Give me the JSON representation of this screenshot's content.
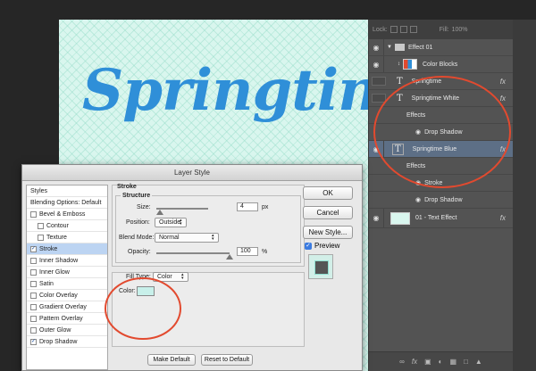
{
  "canvas": {
    "title_text": "Springtime"
  },
  "layers_panel": {
    "lock_label": "Lock:",
    "fill_label": "Fill:",
    "fill_value": "100%",
    "rows": [
      {
        "name": "Effect 01",
        "type": "group"
      },
      {
        "name": "Color Blocks",
        "type": "smart"
      },
      {
        "name": "Springtime",
        "type": "text",
        "fx": "fx"
      },
      {
        "name": "Springtime White",
        "type": "text",
        "fx": "fx"
      },
      {
        "name": "Effects",
        "type": "effects-header"
      },
      {
        "name": "Drop Shadow",
        "type": "effect"
      },
      {
        "name": "Springtime Blue",
        "type": "text",
        "fx": "fx",
        "selected": true
      },
      {
        "name": "Effects",
        "type": "effects-header"
      },
      {
        "name": "Stroke",
        "type": "effect"
      },
      {
        "name": "Drop Shadow",
        "type": "effect"
      },
      {
        "name": "01 - Text Effect",
        "type": "image",
        "fx": "fx"
      }
    ],
    "bottom_icons": [
      "link-icon",
      "fx-icon",
      "mask-icon",
      "adjustment-icon",
      "folder-icon",
      "new-layer-icon",
      "trash-icon"
    ]
  },
  "dialog": {
    "title": "Layer Style",
    "styles_header": "Styles",
    "blending": "Blending Options: Default",
    "style_items": [
      {
        "label": "Bevel & Emboss",
        "checked": false
      },
      {
        "label": "Contour",
        "checked": false,
        "indent": true
      },
      {
        "label": "Texture",
        "checked": false,
        "indent": true
      },
      {
        "label": "Stroke",
        "checked": true,
        "selected": true
      },
      {
        "label": "Inner Shadow",
        "checked": false
      },
      {
        "label": "Inner Glow",
        "checked": false
      },
      {
        "label": "Satin",
        "checked": false
      },
      {
        "label": "Color Overlay",
        "checked": false
      },
      {
        "label": "Gradient Overlay",
        "checked": false
      },
      {
        "label": "Pattern Overlay",
        "checked": false
      },
      {
        "label": "Outer Glow",
        "checked": false
      },
      {
        "label": "Drop Shadow",
        "checked": true
      }
    ],
    "stroke": {
      "section": "Stroke",
      "structure": "Structure",
      "size_label": "Size:",
      "size_value": "4",
      "size_unit": "px",
      "position_label": "Position:",
      "position_value": "Outside",
      "blend_label": "Blend Mode:",
      "blend_value": "Normal",
      "opacity_label": "Opacity:",
      "opacity_value": "100",
      "opacity_unit": "%",
      "filltype_label": "Fill Type:",
      "filltype_value": "Color",
      "color_label": "Color:",
      "color_hex": "#c8f0ea",
      "make_default": "Make Default",
      "reset_default": "Reset to Default"
    },
    "buttons": {
      "ok": "OK",
      "cancel": "Cancel",
      "new_style": "New Style...",
      "preview": "Preview"
    }
  },
  "colors": {
    "accent_text": "#2f8fd8",
    "annotation": "#e24a2f"
  }
}
